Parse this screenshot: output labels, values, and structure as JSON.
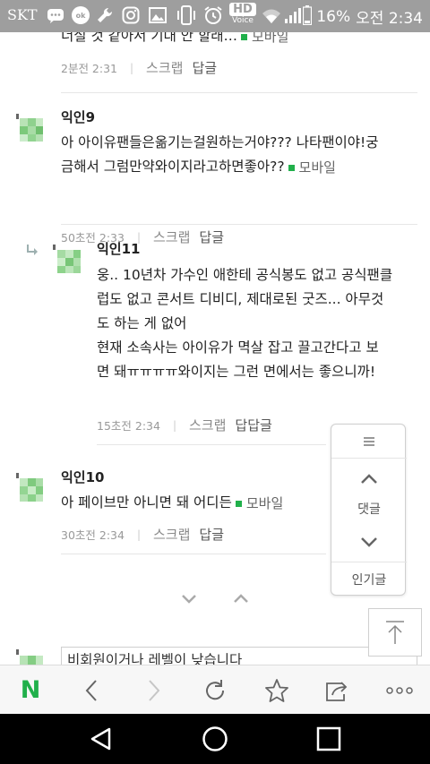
{
  "status_bar": {
    "carrier": "SKT",
    "voice_label": "HD",
    "voice_sub": "Voice",
    "battery": "16%",
    "time": "오전 2:34"
  },
  "comments": [
    {
      "body_lines": [
        "너실 것 같아서 기대 안 할래…"
      ],
      "source": "모바일",
      "time": "2분전 2:31",
      "scrap": "스크랩",
      "reply": "답글"
    },
    {
      "nickname": "익인9",
      "body_lines": [
        "아 아이유팬들은옮기는걸원하는거야??? 나타팬이야!궁",
        "금해서 그럼만약와이지라고하면좋아??"
      ],
      "source": "모바일",
      "time": "50초전 2:33",
      "scrap": "스크랩",
      "reply": "답글"
    },
    {
      "nickname": "익인11",
      "body_lines": [
        "웅.. 10년차 가수인 애한테 공식봉도 없고 공식팬클",
        "럽도 없고 콘서트 디비디, 제대로된 굿즈... 아무것",
        "도 하는 게 없어",
        "현재 소속사는 아이유가 멱살 잡고 끌고간다고 보",
        "면 돼ㅠㅠㅠㅠ와이지는 그런 면에서는 좋으니까!"
      ],
      "time": "15초전 2:34",
      "scrap": "스크랩",
      "reply": "답답글"
    },
    {
      "nickname": "익인10",
      "body_lines": [
        "아 페이브만 아니면 돼 어디든"
      ],
      "source": "모바일",
      "time": "30초전 2:34",
      "scrap": "스크랩",
      "reply": "답글"
    }
  ],
  "float_panel": {
    "comments_label": "댓글",
    "popular_label": "인기글"
  },
  "comment_input": {
    "text": "비회원이거나 레벨이 낮습니다"
  },
  "toolbar": {
    "logo": "N"
  },
  "colors": {
    "status_bar_bg": "#9e9e9e",
    "naver_green": "#21b04b",
    "avatar_green": "#8fd18e"
  }
}
